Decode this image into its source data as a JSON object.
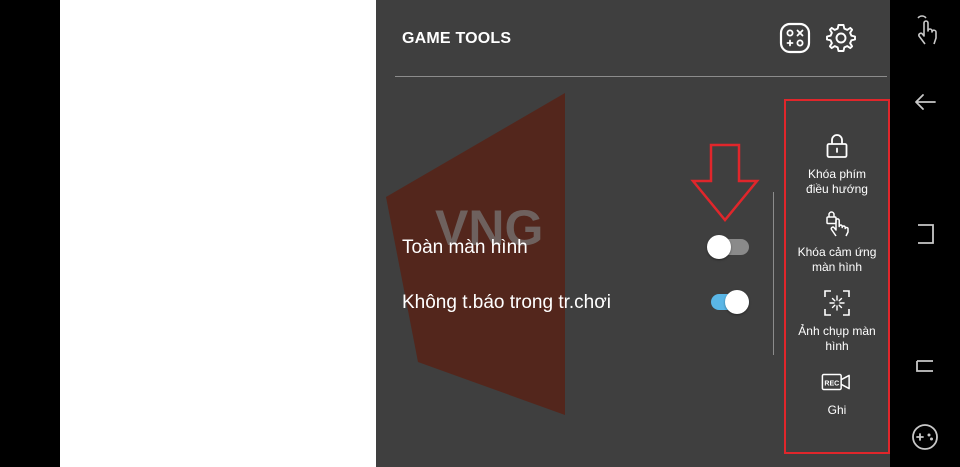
{
  "panel": {
    "title": "GAME TOOLS",
    "header_icons": [
      "game-launcher-icon",
      "gear-icon"
    ],
    "watermark_text": "VNG",
    "settings": [
      {
        "label": "Toàn màn hình",
        "state": "off"
      },
      {
        "label": "Không t.báo trong tr.chơi",
        "state": "on"
      }
    ],
    "tools": [
      {
        "label_line1": "Khóa phím",
        "label_line2": "điều hướng",
        "icon": "lock-icon"
      },
      {
        "label_line1": "Khóa cảm ứng",
        "label_line2": "màn hình",
        "icon": "touch-lock-icon"
      },
      {
        "label_line1": "Ảnh chụp màn",
        "label_line2": "hình",
        "icon": "screenshot-icon"
      },
      {
        "label_line1": "Ghi",
        "label_line2": "",
        "icon": "record-icon"
      }
    ],
    "record_icon_text": "REC"
  },
  "colors": {
    "panel_bg": "#3f3f3f",
    "highlight_red": "#e0262b",
    "toggle_on": "#5ab6e6",
    "watermark": "#5b1f12"
  },
  "navbar": {
    "icons": [
      "touch-gesture-icon",
      "back-icon",
      "recents-icon",
      "return-icon",
      "game-pad-icon"
    ]
  }
}
